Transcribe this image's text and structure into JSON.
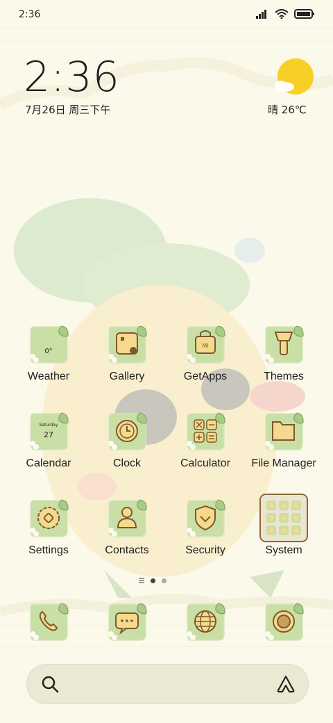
{
  "status_bar": {
    "time": "2:36",
    "icons": [
      "signal-icon",
      "wifi-icon",
      "battery-icon"
    ]
  },
  "clock_widget": {
    "time": "2:36",
    "date": "7月26日 周三下午"
  },
  "weather_widget": {
    "condition": "晴",
    "temperature": "26℃",
    "icon": "sun-cloud-icon"
  },
  "apps": {
    "weather": {
      "label": "Weather",
      "detail": "0°",
      "icon": "weather-icon"
    },
    "gallery": {
      "label": "Gallery",
      "icon": "gallery-icon"
    },
    "getapps": {
      "label": "GetApps",
      "detail": "MI",
      "icon": "shopping-bag-icon"
    },
    "themes": {
      "label": "Themes",
      "icon": "paint-brush-icon"
    },
    "calendar": {
      "label": "Calendar",
      "day": "Saturday",
      "date": "27",
      "icon": "calendar-icon"
    },
    "clock": {
      "label": "Clock",
      "icon": "clock-icon"
    },
    "calculator": {
      "label": "Calculator",
      "icon": "calculator-icon"
    },
    "file_manager": {
      "label": "File Manager",
      "icon": "folder-icon"
    },
    "settings": {
      "label": "Settings",
      "icon": "gear-icon"
    },
    "contacts": {
      "label": "Contacts",
      "icon": "person-icon"
    },
    "security": {
      "label": "Security",
      "icon": "shield-icon"
    },
    "system": {
      "label": "System",
      "icon": "folder-grid-icon"
    }
  },
  "dock": [
    {
      "name": "phone",
      "icon": "phone-icon"
    },
    {
      "name": "messages",
      "icon": "message-icon"
    },
    {
      "name": "browser",
      "icon": "globe-icon"
    },
    {
      "name": "camera",
      "icon": "camera-icon"
    }
  ],
  "page_indicator": {
    "pages": 2,
    "current": 1
  },
  "colors": {
    "background": "#fbf9ea",
    "icon_bg": "#c5dca0",
    "icon_border": "#8a6a3e",
    "icon_fill": "#f6d98d"
  }
}
